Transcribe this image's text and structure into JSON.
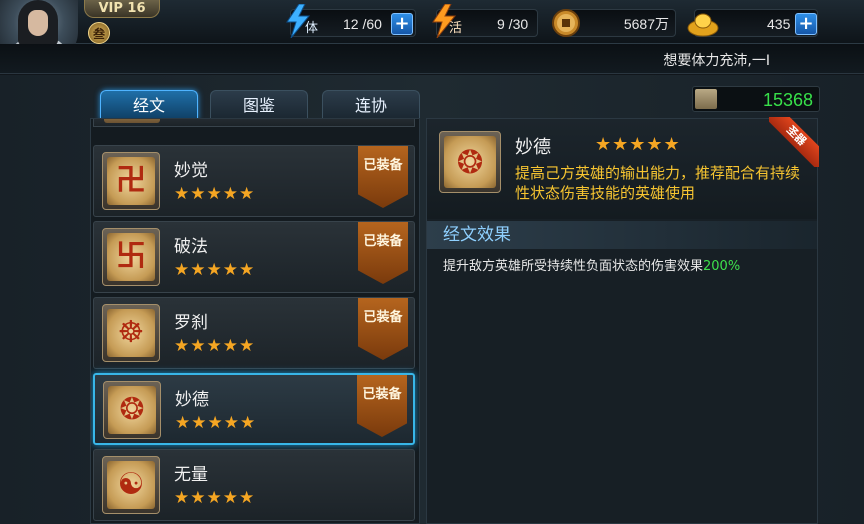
{
  "header": {
    "vip_label": "VIP 16",
    "rank_badge": "叁",
    "stamina": {
      "icon_label": "体",
      "value": "12 /60"
    },
    "activity": {
      "icon_label": "活",
      "value": "9 /30"
    },
    "coins": {
      "value": "5687万"
    },
    "ingots": {
      "value": "435"
    },
    "plus_label": "+",
    "ticker_text": "想要体力充沛,一I"
  },
  "tabs": [
    {
      "label": "经文",
      "active": true
    },
    {
      "label": "图鉴",
      "active": false
    },
    {
      "label": "连协",
      "active": false
    }
  ],
  "score": {
    "value": "15368"
  },
  "scripture_list": [
    {
      "name": "妙觉",
      "stars": "★★★★★",
      "equipped_label": "已装备",
      "glyph": "卍",
      "selected": false
    },
    {
      "name": "破法",
      "stars": "★★★★★",
      "equipped_label": "已装备",
      "glyph": "卐",
      "selected": false
    },
    {
      "name": "罗刹",
      "stars": "★★★★★",
      "equipped_label": "已装备",
      "glyph": "☸",
      "selected": false
    },
    {
      "name": "妙德",
      "stars": "★★★★★",
      "equipped_label": "已装备",
      "glyph": "❂",
      "selected": true
    },
    {
      "name": "无量",
      "stars": "★★★★★",
      "equipped_label": "",
      "glyph": "☯",
      "selected": false
    }
  ],
  "detail": {
    "name": "妙德",
    "stars": "★★★★★",
    "ribbon": "圣器",
    "glyph": "❂",
    "description": "提高己方英雄的输出能力，推荐配合有持续性状态伤害技能的英雄使用",
    "section_title": "经文效果",
    "effect_text": "提升敌方英雄所受持续性负面状态的伤害效果",
    "effect_value": "200%"
  },
  "colors": {
    "accent_blue": "#38b6e8",
    "star_gold": "#f5a623",
    "desc_yellow": "#f7c531",
    "value_green": "#3ee04c",
    "equip_orange": "#b5651e"
  }
}
